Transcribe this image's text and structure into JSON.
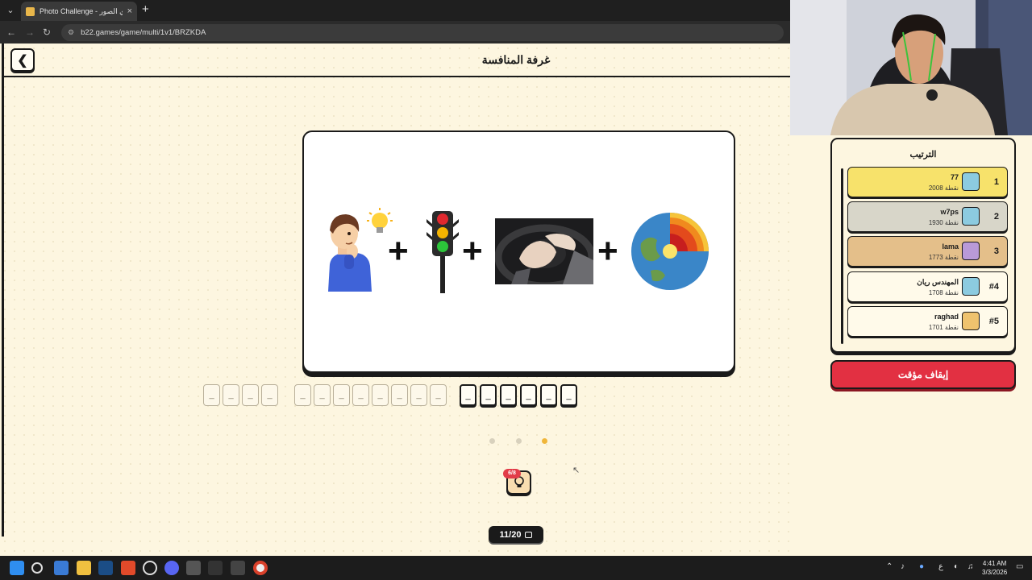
{
  "browser": {
    "tab_title": "Photo Challenge - تحدي الصور",
    "tab_close": "×",
    "new_tab": "+",
    "url": "b22.games/game/multi/1v1/BRZKDA"
  },
  "header": {
    "back_glyph": "❮",
    "title": "غرفة المنافسة"
  },
  "puzzle": {
    "images": [
      "thinking-boy-with-lightbulb",
      "traffic-light",
      "hands-on-car-horn",
      "earth-core-cross-section"
    ],
    "plus": "+",
    "answer_groups": [
      {
        "letters": 4,
        "active": false
      },
      {
        "letters": 8,
        "active": false
      },
      {
        "letters": 6,
        "active": true
      }
    ],
    "slot_char": "_"
  },
  "pagination": {
    "count": 3,
    "active_index": 2
  },
  "hints": {
    "badge": "6/8"
  },
  "progress": {
    "counter": "11/20"
  },
  "leaderboard": {
    "title": "الترتيب",
    "players": [
      {
        "rank": "1",
        "name": "77",
        "score": "2008 نقطة",
        "color": "#f7e26b",
        "avatar_color": "#8ccbe0"
      },
      {
        "rank": "2",
        "name": "w7ps",
        "score": "1930 نقطة",
        "color": "#d8d6c9",
        "avatar_color": "#8ccbe0"
      },
      {
        "rank": "3",
        "name": "lama",
        "score": "1773 نقطة",
        "color": "#e4bf8a",
        "avatar_color": "#b99ad8"
      },
      {
        "rank": "#4",
        "name": "المهندس ريان",
        "score": "1708 نقطة",
        "color": "#fffaea",
        "avatar_color": "#8ccbe0"
      },
      {
        "rank": "#5",
        "name": "raghad",
        "score": "1701 نقطة",
        "color": "#fffaea",
        "avatar_color": "#efc36e"
      }
    ]
  },
  "pause_button": "إيقاف مؤقت",
  "clock": {
    "time": "4:41 AM",
    "date": "3/3/2026"
  },
  "tray": {
    "lang": "ع"
  }
}
